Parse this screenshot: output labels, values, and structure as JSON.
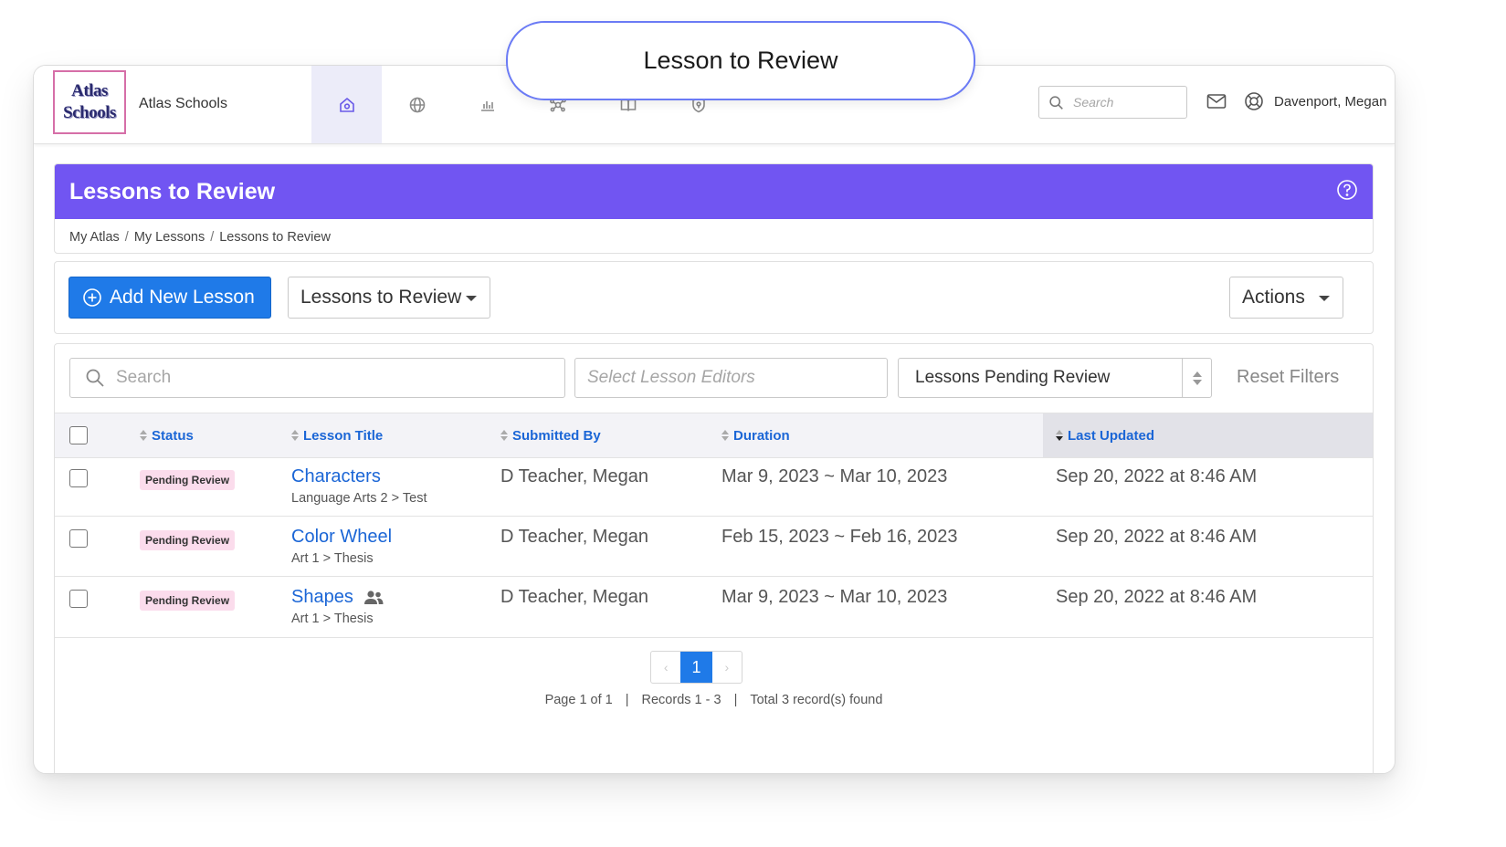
{
  "callout": {
    "title": "Lesson to Review"
  },
  "navbar": {
    "logo_line1": "Atlas",
    "logo_line2": "Schools",
    "school_name": "Atlas Schools",
    "icons": [
      "home-icon",
      "globe-icon",
      "bar-chart-icon",
      "network-icon",
      "book-icon",
      "shield-icon"
    ],
    "search_placeholder": "Search",
    "user_name": "Davenport, Megan"
  },
  "header": {
    "title": "Lessons to Review",
    "breadcrumb": [
      "My Atlas",
      "My Lessons",
      "Lessons to Review"
    ]
  },
  "toolbar": {
    "add_label": "Add New Lesson",
    "view_label": "Lessons to Review",
    "actions_label": "Actions"
  },
  "filters": {
    "search_placeholder": "Search",
    "editors_placeholder": "Select Lesson Editors",
    "status_value": "Lessons Pending Review",
    "reset_label": "Reset Filters"
  },
  "table": {
    "columns": [
      "Status",
      "Lesson Title",
      "Submitted By",
      "Duration",
      "Last Updated"
    ],
    "rows": [
      {
        "status": "Pending Review",
        "title": "Characters",
        "subtitle": "Language Arts 2 > Test",
        "submitted_by": "D Teacher, Megan",
        "duration": "Mar 9, 2023 ~ Mar 10, 2023",
        "last_updated": "Sep 20, 2022 at 8:46 AM"
      },
      {
        "status": "Pending Review",
        "title": "Color Wheel",
        "subtitle": "Art 1 > Thesis",
        "submitted_by": "D Teacher, Megan",
        "duration": "Feb 15, 2023 ~ Feb 16, 2023",
        "last_updated": "Sep 20, 2022 at 8:46 AM"
      },
      {
        "status": "Pending Review",
        "title": "Shapes",
        "subtitle": "Art 1 > Thesis",
        "submitted_by": "D Teacher, Megan",
        "duration": "Mar 9, 2023 ~ Mar 10, 2023",
        "last_updated": "Sep 20, 2022 at 8:46 AM"
      }
    ]
  },
  "pagination": {
    "current_page": "1",
    "page_text": "Page 1 of 1",
    "records_text": "Records 1 - 3",
    "total_text": "Total 3 record(s) found"
  },
  "colors": {
    "accent_purple": "#7155f2",
    "primary_blue": "#1f7ae8",
    "link_blue": "#1b66d6",
    "badge_pink": "#fbdcec"
  }
}
